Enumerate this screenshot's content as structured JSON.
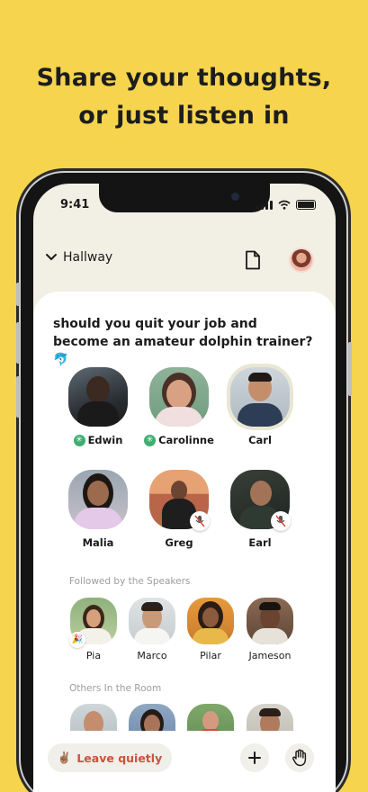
{
  "headline": {
    "line1": "Share your thoughts,",
    "line2": "or just listen in"
  },
  "status": {
    "time": "9:41"
  },
  "topbar": {
    "back_label": "Hallway"
  },
  "room": {
    "topic": "should you quit your job and become an amateur dolphin trainer? 🐬"
  },
  "speakers": [
    {
      "name": "Edwin",
      "moderator": true,
      "muted": false
    },
    {
      "name": "Carolinne",
      "moderator": true,
      "muted": false
    },
    {
      "name": "Carl",
      "moderator": false,
      "muted": false,
      "speaking": true
    },
    {
      "name": "Malia",
      "moderator": false,
      "muted": false
    },
    {
      "name": "Greg",
      "moderator": false,
      "muted": true
    },
    {
      "name": "Earl",
      "moderator": false,
      "muted": true
    }
  ],
  "sections": {
    "followed": "Followed by the Speakers",
    "others": "Others In the Room"
  },
  "followed_listeners": [
    {
      "name": "Pia",
      "new": true
    },
    {
      "name": "Marco"
    },
    {
      "name": "Pilar"
    },
    {
      "name": "Jameson"
    }
  ],
  "bottom": {
    "leave_label": "Leave quietly",
    "leave_emoji": "✌🏽"
  },
  "icons": {
    "moderator_badge": "✳",
    "new_badge": "🎉",
    "hand": "✋"
  },
  "colors": {
    "background": "#f6d44e",
    "leave_text": "#c9533d",
    "moderator": "#3fae70"
  }
}
